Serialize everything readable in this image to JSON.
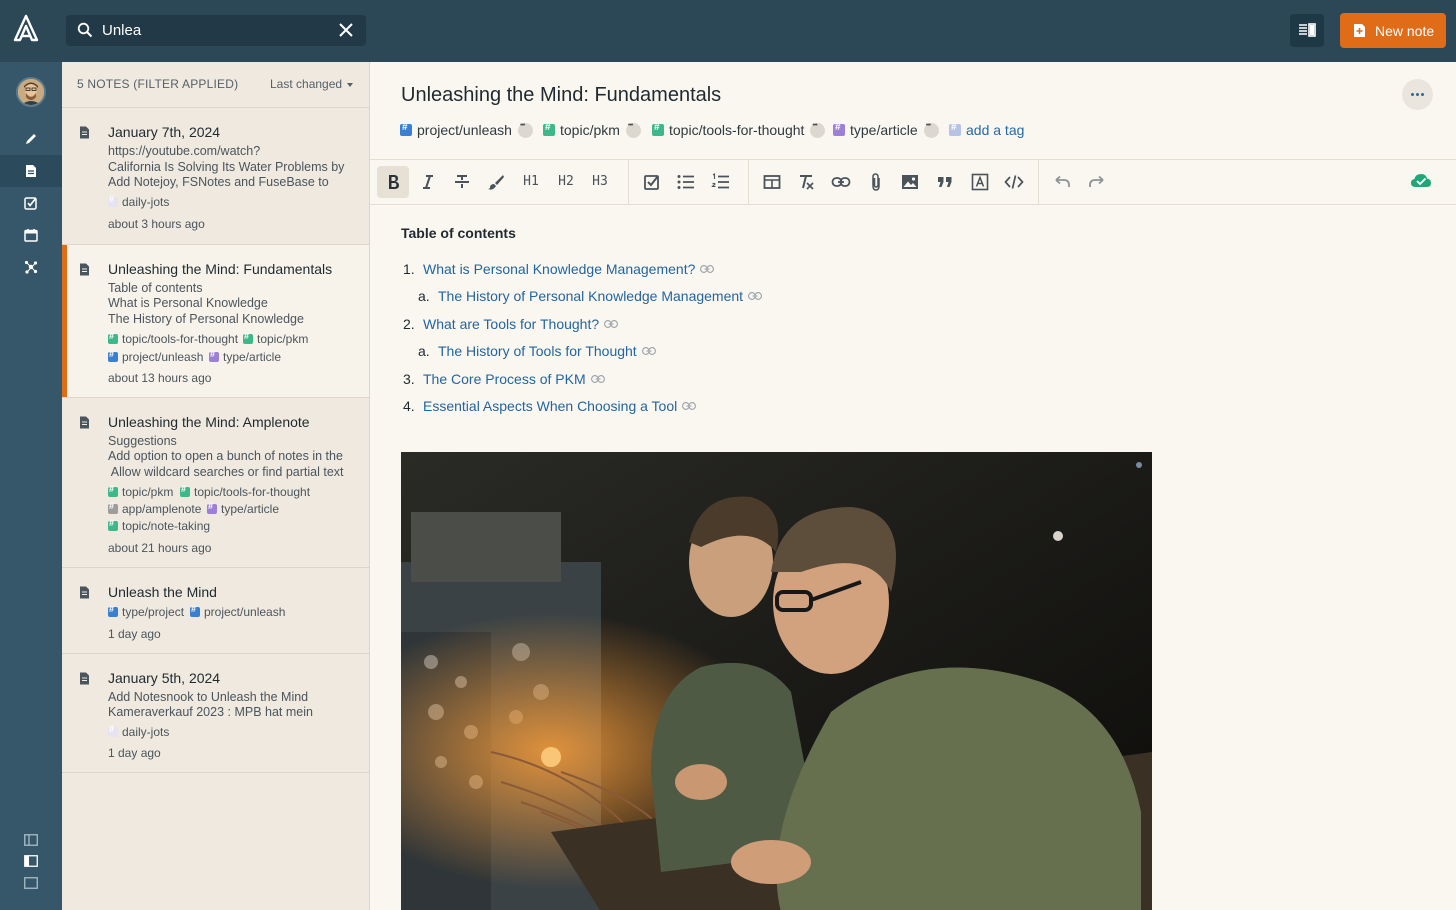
{
  "search": {
    "value": "Unlea",
    "placeholder": "Search"
  },
  "header": {
    "new_note_label": "New note"
  },
  "sidebar": {
    "items": [
      {
        "name": "edit-icon"
      },
      {
        "name": "notes-icon",
        "active": true
      },
      {
        "name": "tasks-icon"
      },
      {
        "name": "calendar-icon"
      },
      {
        "name": "graph-icon"
      }
    ]
  },
  "note_list": {
    "header": "5 NOTES (FILTER APPLIED)",
    "sort_label": "Last changed",
    "notes": [
      {
        "title": "January 7th, 2024",
        "lines": [
          "https://youtube.com/watch?",
          "California Is Solving Its Water Problems by",
          "Add Notejoy, FSNotes and FuseBase to"
        ],
        "tags": [
          {
            "label": "daily-jots",
            "color": "#e7e3f2"
          }
        ],
        "time": "about 3 hours ago"
      },
      {
        "title": "Unleashing the Mind: Fundamentals",
        "lines": [
          "Table of contents",
          "What is Personal Knowledge",
          "The History of Personal Knowledge"
        ],
        "tags": [
          {
            "label": "topic/tools-for-thought",
            "color": "#3db88a"
          },
          {
            "label": "topic/pkm",
            "color": "#3db88a"
          },
          {
            "label": "project/unleash",
            "color": "#3a7fd0"
          },
          {
            "label": "type/article",
            "color": "#9c7fd6"
          }
        ],
        "time": "about 13 hours ago",
        "active": true
      },
      {
        "title": "Unleashing the Mind: Amplenote",
        "lines": [
          "Suggestions",
          "Add option to open a bunch of notes in the",
          " Allow wildcard searches or find partial text"
        ],
        "tags": [
          {
            "label": "topic/pkm",
            "color": "#3db88a"
          },
          {
            "label": "topic/tools-for-thought",
            "color": "#3db88a"
          },
          {
            "label": "app/amplenote",
            "color": "#9d9d9d"
          },
          {
            "label": "type/article",
            "color": "#9c7fd6"
          },
          {
            "label": "topic/note-taking",
            "color": "#3db88a"
          }
        ],
        "time": "about 21 hours ago"
      },
      {
        "title": "Unleash the Mind",
        "lines": [],
        "tags": [
          {
            "label": "type/project",
            "color": "#3a7fd0"
          },
          {
            "label": "project/unleash",
            "color": "#3a7fd0"
          }
        ],
        "time": "1 day ago"
      },
      {
        "title": "January 5th, 2024",
        "lines": [
          "Add Notesnook to Unleash the Mind",
          "Kameraverkauf 2023 : MPB hat mein"
        ],
        "tags": [
          {
            "label": "daily-jots",
            "color": "#e7e3f2"
          }
        ],
        "time": "1 day ago"
      }
    ]
  },
  "editor": {
    "title": "Unleashing the Mind: Fundamentals",
    "tags": [
      {
        "label": "project/unleash",
        "color": "#3a7fd0"
      },
      {
        "label": "topic/pkm",
        "color": "#3db88a"
      },
      {
        "label": "topic/tools-for-thought",
        "color": "#3db88a"
      },
      {
        "label": "type/article",
        "color": "#9c7fd6"
      }
    ],
    "add_tag_label": "add a tag",
    "toolbar": {
      "h1": "H1",
      "h2": "H2",
      "h3": "H3"
    },
    "toc": {
      "heading": "Table of contents",
      "items": [
        {
          "num": "1.",
          "text": "What is Personal Knowledge Management?"
        },
        {
          "num": "a.",
          "text": "The History of Personal Knowledge Management"
        },
        {
          "num": "2.",
          "text": "What are Tools for Thought?"
        },
        {
          "num": "a.",
          "text": "The History of Tools for Thought"
        },
        {
          "num": "3.",
          "text": "The Core Process of PKM"
        },
        {
          "num": "4.",
          "text": "Essential Aspects When Choosing a Tool"
        }
      ]
    }
  },
  "colors": {
    "topbar": "#2c4756",
    "rail": "#36576a",
    "accent": "#e06c17",
    "link": "#2265a0",
    "sync_ok": "#1fa77a"
  }
}
